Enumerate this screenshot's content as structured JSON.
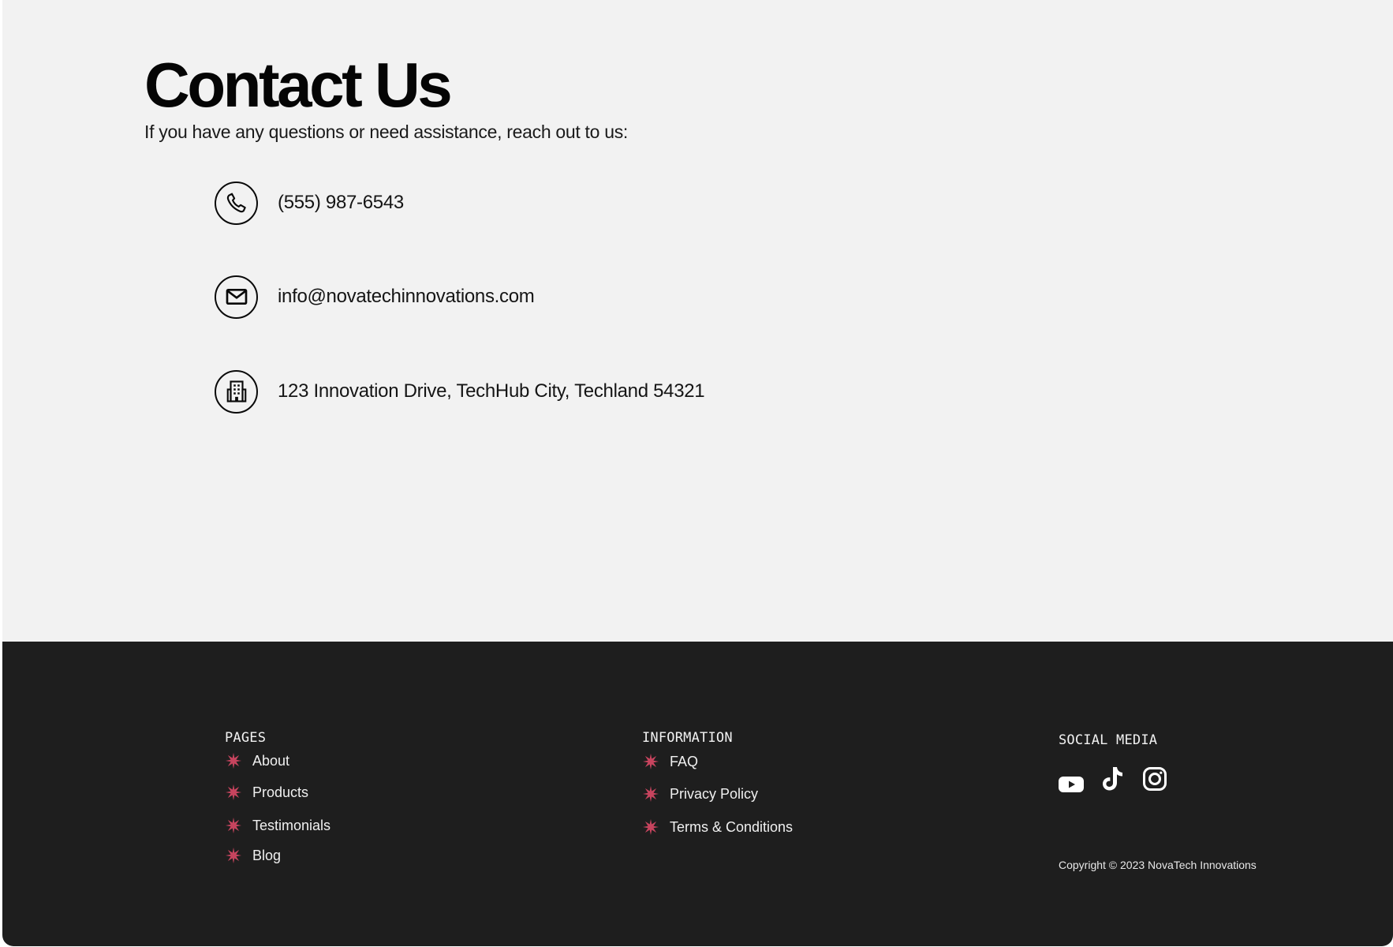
{
  "contact": {
    "title": "Contact Us",
    "subtitle": "If you have any questions or need assistance, reach out to us:",
    "items": [
      {
        "icon": "phone-icon",
        "text": "(555) 987-6543"
      },
      {
        "icon": "mail-icon",
        "text": "info@novatechinnovations.com"
      },
      {
        "icon": "building-icon",
        "text": "123 Innovation Drive, TechHub City, Techland 54321"
      }
    ]
  },
  "footer": {
    "pages": {
      "heading": "PAGES",
      "links": [
        "About",
        "Products",
        "Testimonials",
        "Blog"
      ]
    },
    "information": {
      "heading": "INFORMATION",
      "links": [
        "FAQ",
        "Privacy Policy",
        "Terms & Conditions"
      ]
    },
    "social": {
      "heading": "SOCIAL MEDIA",
      "icons": [
        "youtube-icon",
        "tiktok-icon",
        "instagram-icon"
      ]
    },
    "copyright": "Copyright © 2023 NovaTech Innovations"
  },
  "colors": {
    "page_bg": "#f2f2f2",
    "footer_bg": "#1e1e1e",
    "accent_star": "#c7445e"
  }
}
